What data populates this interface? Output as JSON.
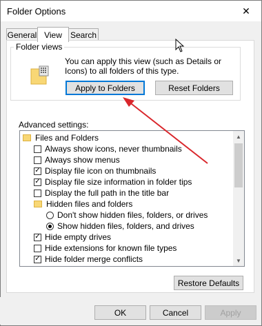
{
  "window": {
    "title": "Folder Options"
  },
  "titlebar": {
    "close_glyph": "✕"
  },
  "tabs": [
    {
      "label": "General",
      "active": false
    },
    {
      "label": "View",
      "active": true
    },
    {
      "label": "Search",
      "active": false
    }
  ],
  "folder_views": {
    "group_label": "Folder views",
    "description": "You can apply this view (such as Details or Icons) to all folders of this type.",
    "apply_button": "Apply to Folders",
    "reset_button": "Reset Folders"
  },
  "advanced": {
    "label": "Advanced settings:",
    "items": [
      {
        "type": "folder",
        "label": "Files and Folders"
      },
      {
        "type": "checkbox",
        "checked": false,
        "label": "Always show icons, never thumbnails"
      },
      {
        "type": "checkbox",
        "checked": false,
        "label": "Always show menus"
      },
      {
        "type": "checkbox",
        "checked": true,
        "label": "Display file icon on thumbnails"
      },
      {
        "type": "checkbox",
        "checked": true,
        "label": "Display file size information in folder tips"
      },
      {
        "type": "checkbox",
        "checked": false,
        "label": "Display the full path in the title bar"
      },
      {
        "type": "folder",
        "label": "Hidden files and folders"
      },
      {
        "type": "radio",
        "checked": false,
        "label": "Don't show hidden files, folders, or drives"
      },
      {
        "type": "radio",
        "checked": true,
        "label": "Show hidden files, folders, and drives"
      },
      {
        "type": "checkbox",
        "checked": true,
        "label": "Hide empty drives"
      },
      {
        "type": "checkbox",
        "checked": false,
        "label": "Hide extensions for known file types"
      },
      {
        "type": "checkbox",
        "checked": true,
        "label": "Hide folder merge conflicts"
      }
    ],
    "check_glyph": "✓",
    "scroll_up_glyph": "▲",
    "scroll_down_glyph": "▼"
  },
  "restore_button": "Restore Defaults",
  "footer": {
    "ok": "OK",
    "cancel": "Cancel",
    "apply": "Apply"
  },
  "colors": {
    "accent": "#0078d7",
    "annotation_arrow": "#d9262b",
    "folder": "#f8d775"
  }
}
